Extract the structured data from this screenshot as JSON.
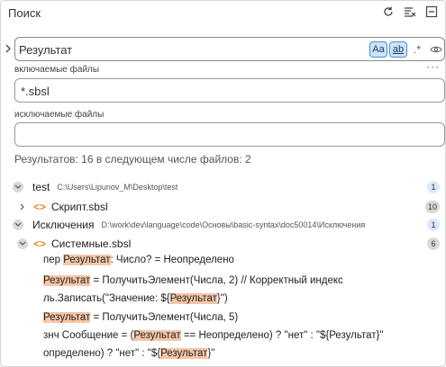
{
  "panel": {
    "title": "Поиск"
  },
  "search": {
    "value": "Результат",
    "match_case_label": "Aa",
    "whole_word_label": "ab",
    "regex_label": ".*"
  },
  "include": {
    "label": "включаемые файлы",
    "value": "*.sbsl"
  },
  "exclude": {
    "label": "исключаемые файлы",
    "value": ""
  },
  "summary": "Результатов: 16 в следующем числе файлов: 2",
  "tree": {
    "test": {
      "name": "test",
      "path": "C:\\Users\\Lipunov_M\\Desktop\\test",
      "count": "1"
    },
    "script": {
      "name": "Скрипт.sbsl",
      "count": "10"
    },
    "exc": {
      "name": "Исключения",
      "path": "D:\\work\\dev\\language\\code\\Основы\\basic-syntax\\doc50014\\Исключения",
      "count": "1"
    },
    "sys": {
      "name": "Системные.sbsl",
      "count": "6"
    }
  },
  "results": [
    {
      "pre": "пер ",
      "hit": "Результат",
      "post": ": Число? = Неопределено"
    },
    {
      "pre": "",
      "hit": "Результат",
      "post": " = ПолучитьЭлемент(Числа, 2) // Корректный индекс"
    },
    {
      "pre": "ль.Записать(\"Значение: ${",
      "hit": "Результат",
      "post": "}\")"
    },
    {
      "pre": "",
      "hit": "Результат",
      "post": " = ПолучитьЭлемент(Числа, 5)"
    },
    {
      "pre": "знч Сообщение = (",
      "hit": "Результат",
      "post": " == Неопределено) ? \"нет\" : \"${Результат}\""
    },
    {
      "pre": "определено) ? \"нет\" : \"${",
      "hit": "Результат",
      "post": "}\""
    }
  ]
}
